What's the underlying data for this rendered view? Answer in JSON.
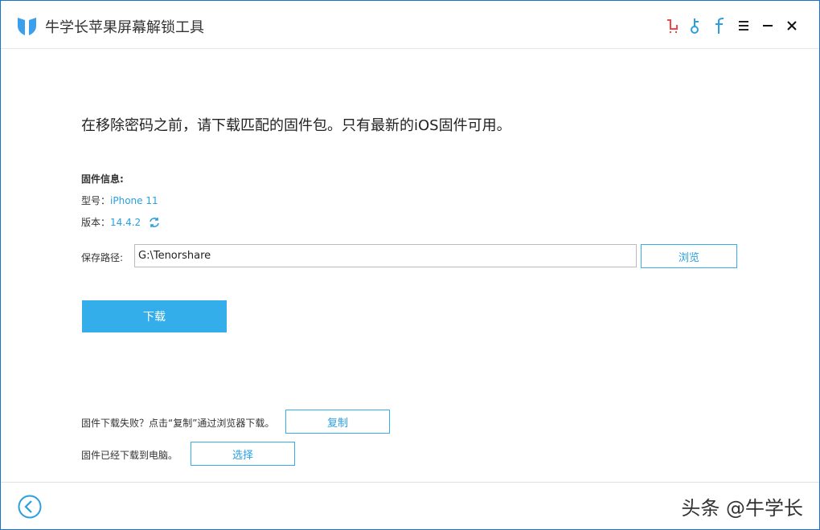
{
  "app": {
    "title": "牛学长苹果屏幕解锁工具",
    "accent": "#33aeea"
  },
  "header_icons": [
    "cart-icon",
    "key-icon",
    "facebook-icon",
    "menu-icon",
    "minimize-icon",
    "close-icon"
  ],
  "main": {
    "headline": "在移除密码之前，请下载匹配的固件包。只有最新的iOS固件可用。",
    "firmware_info_label": "固件信息:",
    "model_label": "型号：",
    "model_value": "iPhone 11",
    "version_label": "版本：",
    "version_value": "14.4.2",
    "save_path_label": "保存路径:",
    "save_path_value": "G:\\Tenorshare",
    "browse_label": "浏览",
    "download_label": "下载",
    "fail_text": "固件下载失败？点击“复制”通过浏览器下载。",
    "copy_label": "复制",
    "downloaded_text": "固件已经下载到电脑。",
    "select_label": "选择"
  },
  "watermark": "头条 @牛学长"
}
